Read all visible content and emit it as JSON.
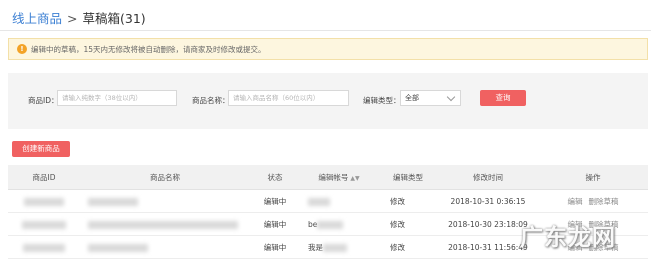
{
  "breadcrumb": {
    "parent": "线上商品",
    "separator": ">",
    "current": "草稿箱(31)"
  },
  "notice": {
    "text": "编辑中的草稿，15天内无修改将被自动删除，请商家及时修改或提交。"
  },
  "filters": {
    "product_id_label": "商品ID：",
    "product_id_placeholder": "请输入纯数字（38位以内）",
    "product_name_label": "商品名称：",
    "product_name_placeholder": "请输入商品名称（60位以内）",
    "edit_type_label": "编辑类型：",
    "edit_type_value": "全部",
    "query_button": "查询"
  },
  "actions": {
    "create_button": "创建新商品"
  },
  "table": {
    "headers": {
      "id": "商品ID",
      "name": "商品名称",
      "status": "状态",
      "editor": "编辑帐号",
      "edit_type": "编辑类型",
      "modified": "修改时间",
      "ops": "操作"
    },
    "rows": [
      {
        "status": "编辑中",
        "editor_prefix": "",
        "edit_type": "修改",
        "time_date": "2018-10-31",
        "time_clock": "0:36:15",
        "op_edit": "编辑",
        "op_delete": "删除草稿"
      },
      {
        "status": "编辑中",
        "editor_prefix": "be",
        "edit_type": "修改",
        "time_date": "2018-10-30",
        "time_clock": "23:18:09",
        "op_edit": "编辑",
        "op_delete": "删除草稿"
      },
      {
        "status": "编辑中",
        "editor_prefix": "我是",
        "edit_type": "修改",
        "time_date": "2018-10-31",
        "time_clock": "11:56:49",
        "op_edit": "编辑",
        "op_delete": "删除草稿"
      }
    ]
  },
  "watermark": {
    "text": "广东龙网"
  },
  "colors": {
    "accent_red": "#f06161",
    "link_blue": "#3b7fd3",
    "notice_bg": "#fdf6df",
    "warn_orange": "#f3a327"
  }
}
